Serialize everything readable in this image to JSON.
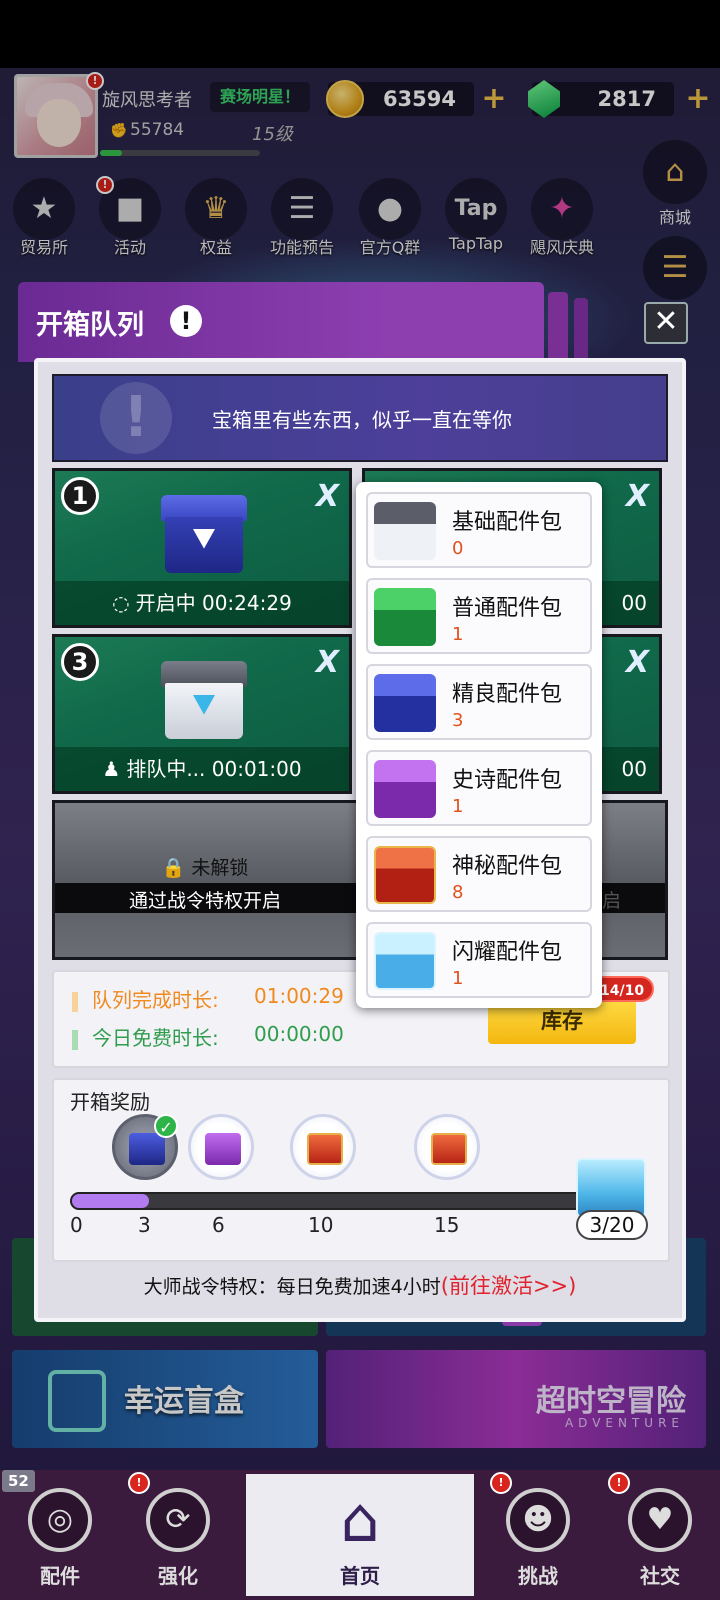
{
  "player": {
    "name": "旋风思考者",
    "title": "赛场明星！",
    "power": "55784",
    "level": "15级",
    "xp_progress": 0.14
  },
  "currency": {
    "coins": "63594",
    "gems": "2817"
  },
  "menu": [
    {
      "label": "贸易所",
      "icon": "trade-icon"
    },
    {
      "label": "活动",
      "icon": "book-icon"
    },
    {
      "label": "权益",
      "icon": "crown-icon"
    },
    {
      "label": "功能预告",
      "icon": "notice-icon"
    },
    {
      "label": "官方Q群",
      "icon": "qq-icon"
    },
    {
      "label": "TapTap",
      "icon": "taptap-icon"
    },
    {
      "label": "飓风庆典",
      "icon": "festival-icon"
    }
  ],
  "side": {
    "shop_label": "商城"
  },
  "modal": {
    "title": "开箱队列",
    "hint": "宝箱里有些东西，似乎一直在等你",
    "slots": [
      {
        "num": "1",
        "status": "开启中 00:24:29"
      },
      {
        "num": "3",
        "status": "排队中... 00:01:00"
      }
    ],
    "slot_partial_times": [
      "00",
      "00"
    ],
    "locked_label": "未解锁",
    "locked_hint": "通过战令特权开启",
    "queue_time_label": "队列完成时长:",
    "queue_time_value": "01:00:29",
    "free_time_label": "今日免费时长:",
    "free_time_value": "00:00:00",
    "inventory_button": "库存",
    "inventory_badge": "14/10",
    "reward_title": "开箱奖励",
    "reward_ticks": [
      "0",
      "3",
      "6",
      "10",
      "15"
    ],
    "reward_count": "3/20",
    "reward_progress": 0.15,
    "battlepass_text": "大师战令特权：每日免费加速4小时",
    "battlepass_link": "(前往激活>>)"
  },
  "packs": [
    {
      "name": "基础配件包",
      "count": "0",
      "color": "gray"
    },
    {
      "name": "普通配件包",
      "count": "1",
      "color": "green"
    },
    {
      "name": "精良配件包",
      "count": "3",
      "color": "blue"
    },
    {
      "name": "史诗配件包",
      "count": "1",
      "color": "purple"
    },
    {
      "name": "神秘配件包",
      "count": "8",
      "color": "red"
    },
    {
      "name": "闪耀配件包",
      "count": "1",
      "color": "shine"
    }
  ],
  "promos": {
    "lucky": "幸运盲盒",
    "adventure": "超时空冒险",
    "adventure_sub": "ADVENTURE"
  },
  "nav": {
    "badge_count": "52",
    "items": [
      "配件",
      "强化",
      "首页",
      "挑战",
      "社交"
    ]
  }
}
